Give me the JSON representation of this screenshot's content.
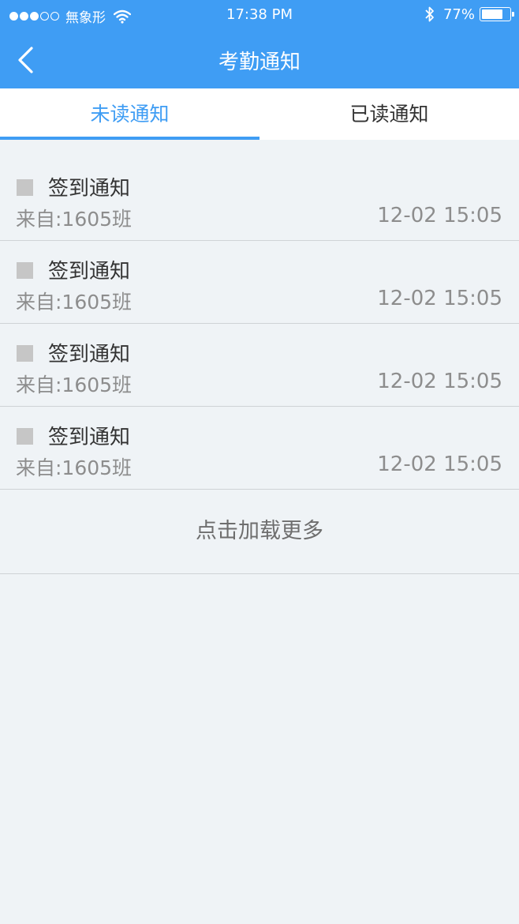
{
  "statusbar": {
    "signal_dots_filled": 3,
    "signal_dots_total": 5,
    "carrier": "無象形",
    "time": "17:38 PM",
    "battery_percent_label": "77%",
    "battery_level": 0.77
  },
  "navbar": {
    "back_icon": "chevron-left-icon",
    "title": "考勤通知"
  },
  "tabs": [
    {
      "label": "未读通知",
      "active": true
    },
    {
      "label": "已读通知",
      "active": false
    }
  ],
  "notifications": [
    {
      "title": "签到通知",
      "from": "来自:1605班",
      "time": "12-02 15:05"
    },
    {
      "title": "签到通知",
      "from": "来自:1605班",
      "time": "12-02 15:05"
    },
    {
      "title": "签到通知",
      "from": "来自:1605班",
      "time": "12-02 15:05"
    },
    {
      "title": "签到通知",
      "from": "来自:1605班",
      "time": "12-02 15:05"
    }
  ],
  "load_more_label": "点击加载更多",
  "colors": {
    "accent": "#3f9df4",
    "background": "#eff3f6",
    "unread_marker": "#c6c6c6",
    "secondary_text": "#8d8d8d"
  }
}
